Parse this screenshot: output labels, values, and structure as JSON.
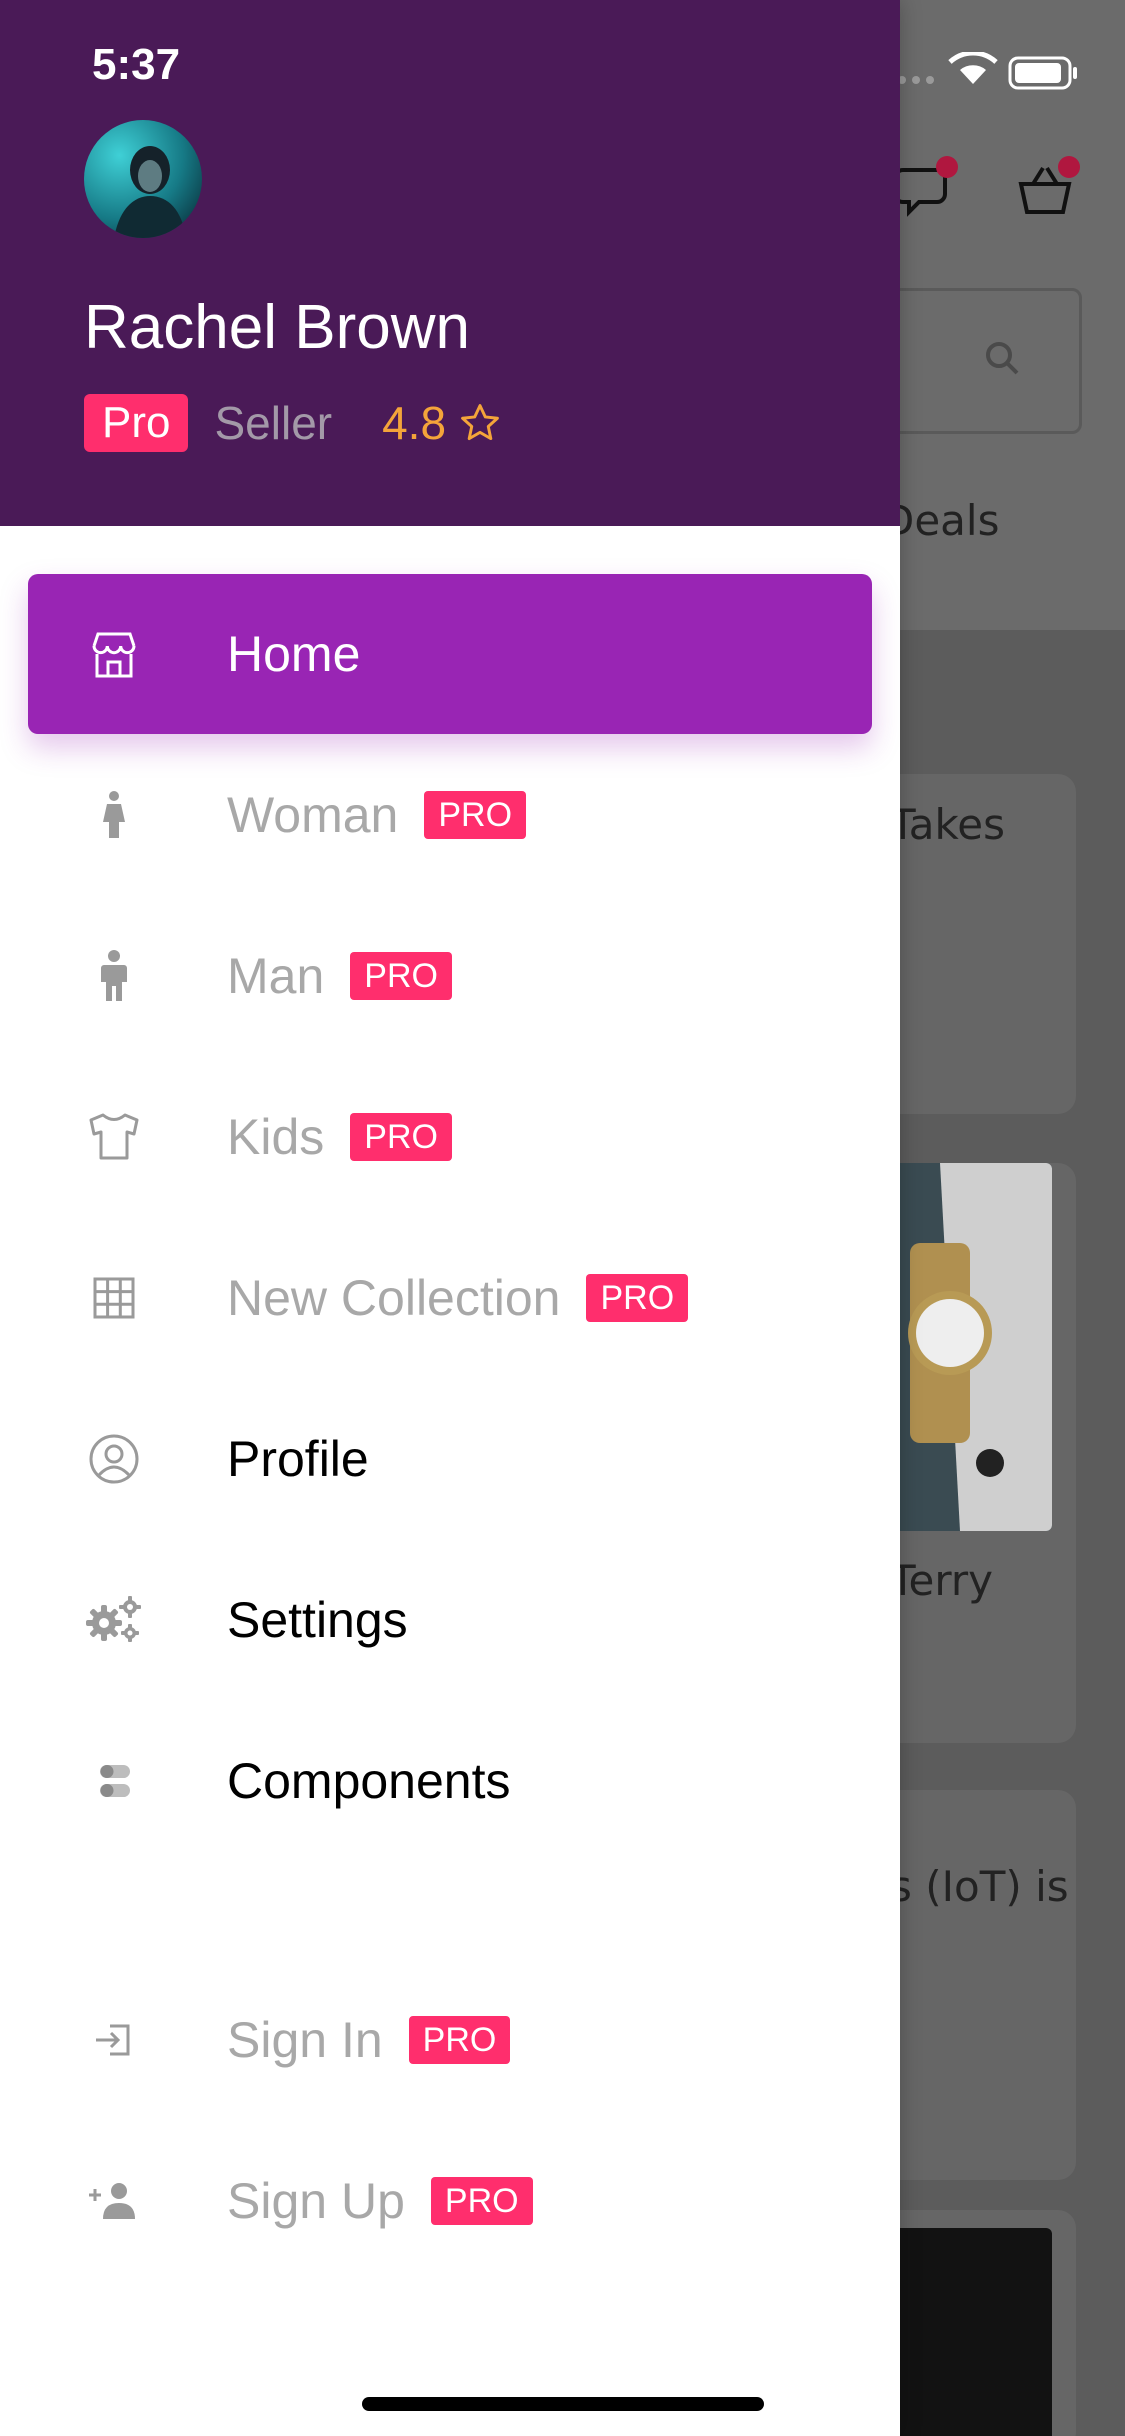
{
  "status_bar": {
    "time": "5:37"
  },
  "background": {
    "fragments": [
      "Deals",
      "Takes",
      "Terry",
      "s (IoT) is"
    ]
  },
  "profile": {
    "name": "Rachel Brown",
    "badge": "Pro",
    "role": "Seller",
    "rating": "4.8",
    "rating_icon": "star-outline-icon"
  },
  "menu": {
    "items": [
      {
        "label": "Home",
        "icon": "store-icon",
        "pro": false,
        "state": "active"
      },
      {
        "label": "Woman",
        "icon": "woman-icon",
        "pro": true,
        "pro_label": "PRO",
        "state": "disabled"
      },
      {
        "label": "Man",
        "icon": "man-icon",
        "pro": true,
        "pro_label": "PRO",
        "state": "disabled"
      },
      {
        "label": "Kids",
        "icon": "kids-shirt-icon",
        "pro": true,
        "pro_label": "PRO",
        "state": "disabled"
      },
      {
        "label": "New Collection",
        "icon": "grid-icon",
        "pro": true,
        "pro_label": "PRO",
        "state": "disabled"
      },
      {
        "label": "Profile",
        "icon": "profile-circle-icon",
        "pro": false,
        "state": "enabled"
      },
      {
        "label": "Settings",
        "icon": "gears-icon",
        "pro": false,
        "state": "enabled"
      },
      {
        "label": "Components",
        "icon": "toggles-icon",
        "pro": false,
        "state": "enabled"
      },
      {
        "label": "Sign In",
        "icon": "sign-in-icon",
        "pro": true,
        "pro_label": "PRO",
        "state": "disabled"
      },
      {
        "label": "Sign Up",
        "icon": "add-user-icon",
        "pro": true,
        "pro_label": "PRO",
        "state": "disabled"
      }
    ]
  },
  "colors": {
    "header_bg": "#4a1a57",
    "active_item": "#9925b4",
    "pro_badge": "#ff2e6d",
    "rating": "#f4a43a"
  }
}
